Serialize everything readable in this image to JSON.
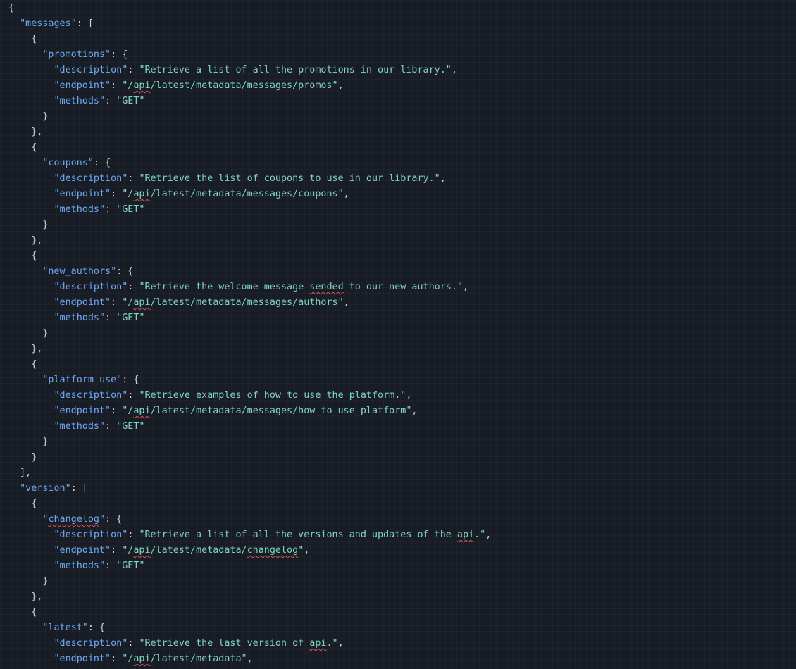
{
  "colors": {
    "background": "#171c25",
    "key": "#6ea8f5",
    "string": "#7fd3c0",
    "punctuation": "#c9d1d9",
    "spellcheck_underline": "#e05555",
    "caret": "#d0d6de"
  },
  "spellcheck_words": [
    "api",
    "sended",
    "changelog"
  ],
  "cursor": {
    "line": 26
  },
  "lines": [
    [
      {
        "t": "p",
        "v": "{"
      }
    ],
    [
      {
        "t": "p",
        "v": "  "
      },
      {
        "t": "k",
        "v": "\"messages\""
      },
      {
        "t": "p",
        "v": ": ["
      }
    ],
    [
      {
        "t": "p",
        "v": "    {"
      }
    ],
    [
      {
        "t": "p",
        "v": "      "
      },
      {
        "t": "k",
        "v": "\"promotions\""
      },
      {
        "t": "p",
        "v": ": {"
      }
    ],
    [
      {
        "t": "p",
        "v": "        "
      },
      {
        "t": "k",
        "v": "\"description\""
      },
      {
        "t": "p",
        "v": ": "
      },
      {
        "t": "s",
        "v": "\"Retrieve a list of all the promotions in our library.\""
      },
      {
        "t": "p",
        "v": ","
      }
    ],
    [
      {
        "t": "p",
        "v": "        "
      },
      {
        "t": "k",
        "v": "\"endpoint\""
      },
      {
        "t": "p",
        "v": ": "
      },
      {
        "t": "s",
        "v": "\"/api/latest/metadata/messages/promos\""
      },
      {
        "t": "p",
        "v": ","
      }
    ],
    [
      {
        "t": "p",
        "v": "        "
      },
      {
        "t": "k",
        "v": "\"methods\""
      },
      {
        "t": "p",
        "v": ": "
      },
      {
        "t": "s",
        "v": "\"GET\""
      }
    ],
    [
      {
        "t": "p",
        "v": "      }"
      }
    ],
    [
      {
        "t": "p",
        "v": "    },"
      }
    ],
    [
      {
        "t": "p",
        "v": "    {"
      }
    ],
    [
      {
        "t": "p",
        "v": "      "
      },
      {
        "t": "k",
        "v": "\"coupons\""
      },
      {
        "t": "p",
        "v": ": {"
      }
    ],
    [
      {
        "t": "p",
        "v": "        "
      },
      {
        "t": "k",
        "v": "\"description\""
      },
      {
        "t": "p",
        "v": ": "
      },
      {
        "t": "s",
        "v": "\"Retrieve the list of coupons to use in our library.\""
      },
      {
        "t": "p",
        "v": ","
      }
    ],
    [
      {
        "t": "p",
        "v": "        "
      },
      {
        "t": "k",
        "v": "\"endpoint\""
      },
      {
        "t": "p",
        "v": ": "
      },
      {
        "t": "s",
        "v": "\"/api/latest/metadata/messages/coupons\""
      },
      {
        "t": "p",
        "v": ","
      }
    ],
    [
      {
        "t": "p",
        "v": "        "
      },
      {
        "t": "k",
        "v": "\"methods\""
      },
      {
        "t": "p",
        "v": ": "
      },
      {
        "t": "s",
        "v": "\"GET\""
      }
    ],
    [
      {
        "t": "p",
        "v": "      }"
      }
    ],
    [
      {
        "t": "p",
        "v": "    },"
      }
    ],
    [
      {
        "t": "p",
        "v": "    {"
      }
    ],
    [
      {
        "t": "p",
        "v": "      "
      },
      {
        "t": "k",
        "v": "\"new_authors\""
      },
      {
        "t": "p",
        "v": ": {"
      }
    ],
    [
      {
        "t": "p",
        "v": "        "
      },
      {
        "t": "k",
        "v": "\"description\""
      },
      {
        "t": "p",
        "v": ": "
      },
      {
        "t": "s",
        "v": "\"Retrieve the welcome message sended to our new authors.\""
      },
      {
        "t": "p",
        "v": ","
      }
    ],
    [
      {
        "t": "p",
        "v": "        "
      },
      {
        "t": "k",
        "v": "\"endpoint\""
      },
      {
        "t": "p",
        "v": ": "
      },
      {
        "t": "s",
        "v": "\"/api/latest/metadata/messages/authors\""
      },
      {
        "t": "p",
        "v": ","
      }
    ],
    [
      {
        "t": "p",
        "v": "        "
      },
      {
        "t": "k",
        "v": "\"methods\""
      },
      {
        "t": "p",
        "v": ": "
      },
      {
        "t": "s",
        "v": "\"GET\""
      }
    ],
    [
      {
        "t": "p",
        "v": "      }"
      }
    ],
    [
      {
        "t": "p",
        "v": "    },"
      }
    ],
    [
      {
        "t": "p",
        "v": "    {"
      }
    ],
    [
      {
        "t": "p",
        "v": "      "
      },
      {
        "t": "k",
        "v": "\"platform_use\""
      },
      {
        "t": "p",
        "v": ": {"
      }
    ],
    [
      {
        "t": "p",
        "v": "        "
      },
      {
        "t": "k",
        "v": "\"description\""
      },
      {
        "t": "p",
        "v": ": "
      },
      {
        "t": "s",
        "v": "\"Retrieve examples of how to use the platform.\""
      },
      {
        "t": "p",
        "v": ","
      }
    ],
    [
      {
        "t": "p",
        "v": "        "
      },
      {
        "t": "k",
        "v": "\"endpoint\""
      },
      {
        "t": "p",
        "v": ": "
      },
      {
        "t": "s",
        "v": "\"/api/latest/metadata/messages/how_to_use_platform\""
      },
      {
        "t": "p",
        "v": ","
      }
    ],
    [
      {
        "t": "p",
        "v": "        "
      },
      {
        "t": "k",
        "v": "\"methods\""
      },
      {
        "t": "p",
        "v": ": "
      },
      {
        "t": "s",
        "v": "\"GET\""
      }
    ],
    [
      {
        "t": "p",
        "v": "      }"
      }
    ],
    [
      {
        "t": "p",
        "v": "    }"
      }
    ],
    [
      {
        "t": "p",
        "v": "  ],"
      }
    ],
    [
      {
        "t": "p",
        "v": "  "
      },
      {
        "t": "k",
        "v": "\"version\""
      },
      {
        "t": "p",
        "v": ": ["
      }
    ],
    [
      {
        "t": "p",
        "v": "    {"
      }
    ],
    [
      {
        "t": "p",
        "v": "      "
      },
      {
        "t": "k",
        "v": "\"changelog\""
      },
      {
        "t": "p",
        "v": ": {"
      }
    ],
    [
      {
        "t": "p",
        "v": "        "
      },
      {
        "t": "k",
        "v": "\"description\""
      },
      {
        "t": "p",
        "v": ": "
      },
      {
        "t": "s",
        "v": "\"Retrieve a list of all the versions and updates of the api.\""
      },
      {
        "t": "p",
        "v": ","
      }
    ],
    [
      {
        "t": "p",
        "v": "        "
      },
      {
        "t": "k",
        "v": "\"endpoint\""
      },
      {
        "t": "p",
        "v": ": "
      },
      {
        "t": "s",
        "v": "\"/api/latest/metadata/changelog\""
      },
      {
        "t": "p",
        "v": ","
      }
    ],
    [
      {
        "t": "p",
        "v": "        "
      },
      {
        "t": "k",
        "v": "\"methods\""
      },
      {
        "t": "p",
        "v": ": "
      },
      {
        "t": "s",
        "v": "\"GET\""
      }
    ],
    [
      {
        "t": "p",
        "v": "      }"
      }
    ],
    [
      {
        "t": "p",
        "v": "    },"
      }
    ],
    [
      {
        "t": "p",
        "v": "    {"
      }
    ],
    [
      {
        "t": "p",
        "v": "      "
      },
      {
        "t": "k",
        "v": "\"latest\""
      },
      {
        "t": "p",
        "v": ": {"
      }
    ],
    [
      {
        "t": "p",
        "v": "        "
      },
      {
        "t": "k",
        "v": "\"description\""
      },
      {
        "t": "p",
        "v": ": "
      },
      {
        "t": "s",
        "v": "\"Retrieve the last version of api.\""
      },
      {
        "t": "p",
        "v": ","
      }
    ],
    [
      {
        "t": "p",
        "v": "        "
      },
      {
        "t": "k",
        "v": "\"endpoint\""
      },
      {
        "t": "p",
        "v": ": "
      },
      {
        "t": "s",
        "v": "\"/api/latest/metadata\""
      },
      {
        "t": "p",
        "v": ","
      }
    ]
  ]
}
